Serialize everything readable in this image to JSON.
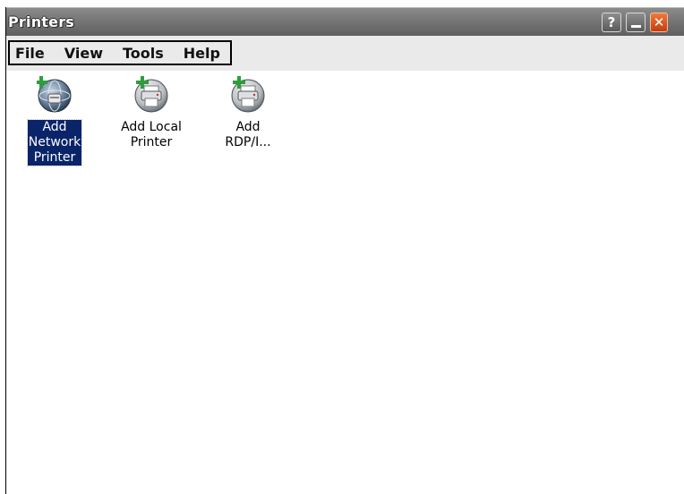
{
  "window": {
    "title": "Printers",
    "controls": {
      "help_label": "?",
      "minimize_label": "_",
      "close_label": "✕"
    }
  },
  "menubar": {
    "items": [
      {
        "label": "File"
      },
      {
        "label": "View"
      },
      {
        "label": "Tools"
      },
      {
        "label": "Help"
      }
    ]
  },
  "items": [
    {
      "label_lines": [
        "Add",
        "Network",
        "Printer"
      ],
      "icon": "network-printer-add-icon",
      "selected": true
    },
    {
      "label_lines": [
        "Add Local",
        "Printer"
      ],
      "icon": "local-printer-add-icon",
      "selected": false
    },
    {
      "label_lines": [
        "Add",
        "RDP/I..."
      ],
      "icon": "rdp-printer-add-icon",
      "selected": false
    }
  ],
  "colors": {
    "selection": "#0a246a",
    "titlebar": "#767676",
    "close_button": "#e05a20"
  }
}
